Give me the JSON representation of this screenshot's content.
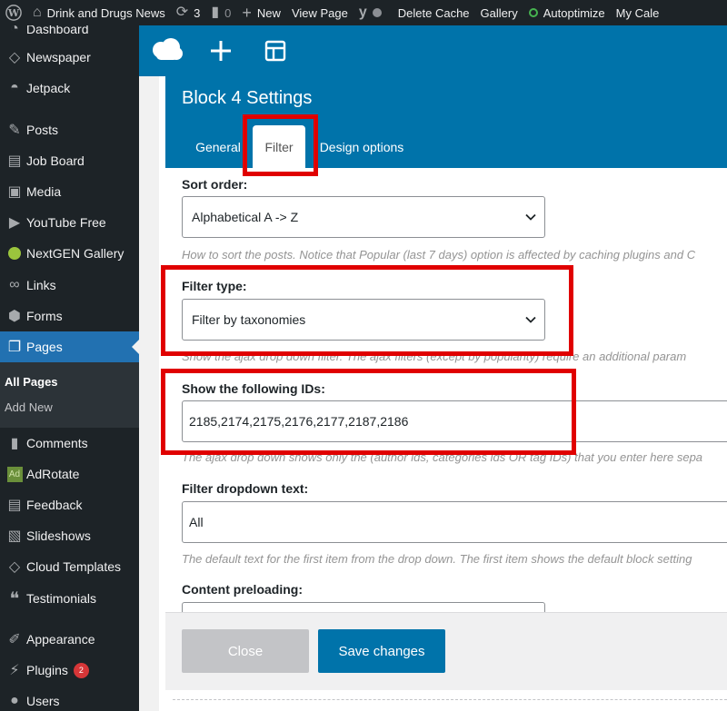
{
  "admin_bar": {
    "site_name": "Drink and Drugs News",
    "updates_count": "3",
    "comments_count": "0",
    "new_label": "New",
    "view_page_label": "View Page",
    "delete_cache_label": "Delete Cache",
    "gallery_label": "Gallery",
    "autoptimize_label": "Autoptimize",
    "calendar_label": "My Cale"
  },
  "sidebar": {
    "items": [
      {
        "label": "Dashboard",
        "icon": "dashboard-icon"
      },
      {
        "label": "Newspaper",
        "icon": "newspaper-icon"
      },
      {
        "label": "Jetpack",
        "icon": "jetpack-icon"
      },
      {
        "label": "Posts",
        "icon": "pin-icon"
      },
      {
        "label": "Job Board",
        "icon": "clipboard-icon"
      },
      {
        "label": "Media",
        "icon": "media-icon"
      },
      {
        "label": "YouTube Free",
        "icon": "youtube-icon"
      },
      {
        "label": "NextGEN Gallery",
        "icon": "nextgen-icon"
      },
      {
        "label": "Links",
        "icon": "link-icon"
      },
      {
        "label": "Forms",
        "icon": "forms-icon"
      },
      {
        "label": "Pages",
        "icon": "pages-icon"
      },
      {
        "label": "Comments",
        "icon": "comment-icon"
      },
      {
        "label": "AdRotate",
        "icon": "adrotate-icon"
      },
      {
        "label": "Feedback",
        "icon": "feedback-icon"
      },
      {
        "label": "Slideshows",
        "icon": "slideshow-icon"
      },
      {
        "label": "Cloud Templates",
        "icon": "cloud-templates-icon"
      },
      {
        "label": "Testimonials",
        "icon": "quote-icon"
      },
      {
        "label": "Appearance",
        "icon": "brush-icon"
      },
      {
        "label": "Plugins",
        "icon": "plugin-icon"
      },
      {
        "label": "Users",
        "icon": "users-icon"
      }
    ],
    "pages_submenu": {
      "all_pages": "All Pages",
      "add_new": "Add New"
    },
    "plugins_badge": "2"
  },
  "modal": {
    "title": "Block 4 Settings",
    "tabs": [
      "General",
      "Filter",
      "Design options"
    ],
    "active_tab": "Filter",
    "fields": {
      "sort_order": {
        "label": "Sort order:",
        "value": "Alphabetical A -> Z",
        "help": "How to sort the posts. Notice that Popular (last 7 days) option is affected by caching plugins and C"
      },
      "filter_type": {
        "label": "Filter type:",
        "value": "Filter by taxonomies",
        "help": "Show the ajax drop down filter. The ajax filters (except by popularity) require an additional param"
      },
      "show_ids": {
        "label": "Show the following IDs:",
        "value": "2185,2174,2175,2176,2177,2187,2186",
        "help": "The ajax drop down shows only the (author ids, categories ids OR tag IDs) that you enter here sepa"
      },
      "dropdown_text": {
        "label": "Filter dropdown text:",
        "value": "All",
        "help": "The default text for the first item from the drop down. The first item shows the default block setting"
      },
      "content_preloading": {
        "label": "Content preloading:"
      }
    },
    "buttons": {
      "close": "Close",
      "save": "Save changes"
    }
  },
  "colors": {
    "admin_dark": "#1d2327",
    "wp_blue": "#0073aa",
    "menu_current": "#2271b1",
    "highlight_red": "#e00000",
    "disabled_button": "#c3c4c7"
  }
}
